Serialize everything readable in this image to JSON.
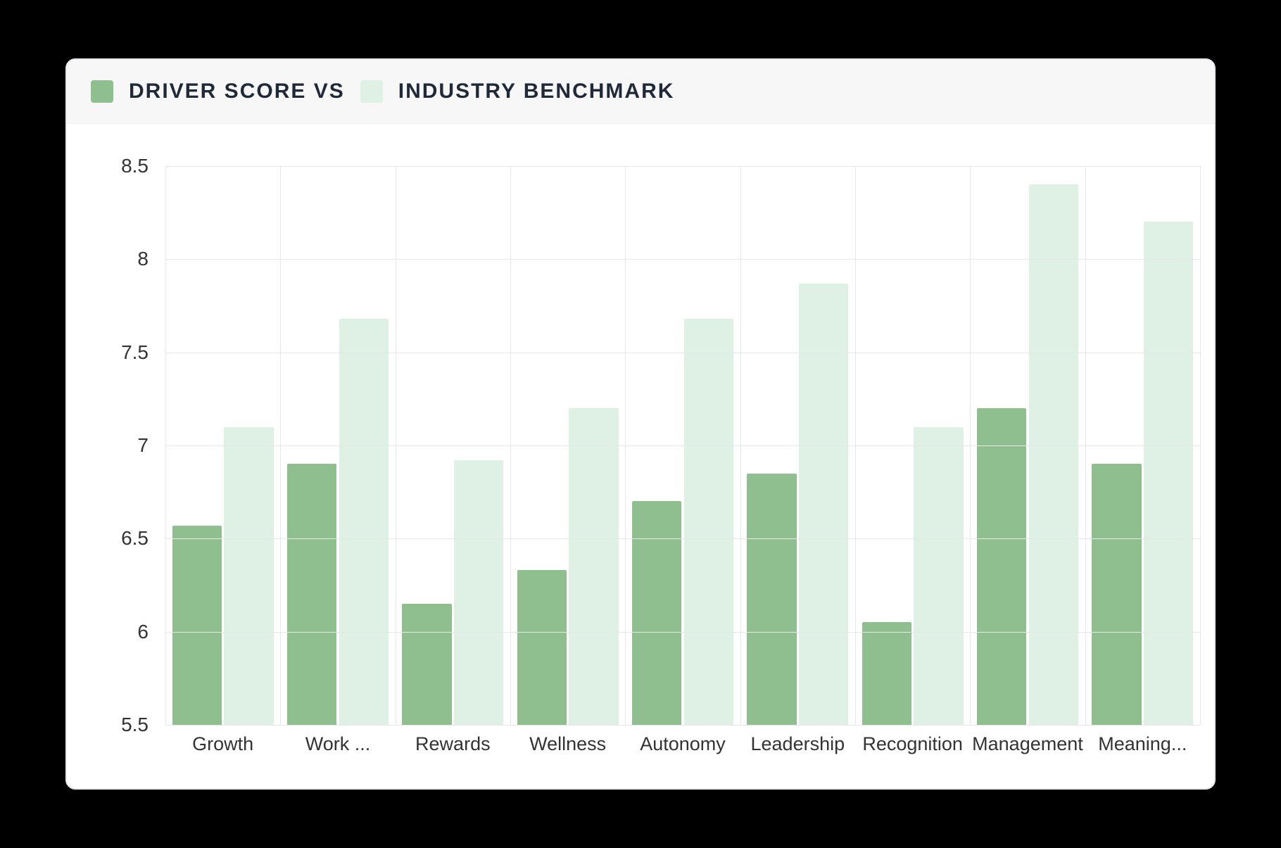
{
  "legend": {
    "driver_label": "DRIVER SCORE VS",
    "benchmark_label": "INDUSTRY BENCHMARK"
  },
  "chart_data": {
    "type": "bar",
    "title": "",
    "xlabel": "",
    "ylabel": "",
    "ylim": [
      5.5,
      8.5
    ],
    "yticks": [
      5.5,
      6,
      6.5,
      7,
      7.5,
      8,
      8.5
    ],
    "categories": [
      "Growth",
      "Work ...",
      "Rewards",
      "Wellness",
      "Autonomy",
      "Leadership",
      "Recognition",
      "Management",
      "Meaning..."
    ],
    "series": [
      {
        "name": "Driver score",
        "values": [
          6.57,
          6.9,
          6.15,
          6.33,
          6.7,
          6.85,
          6.05,
          7.2,
          6.9
        ]
      },
      {
        "name": "Industry benchmark",
        "values": [
          7.1,
          7.68,
          6.92,
          7.2,
          7.68,
          7.87,
          7.1,
          8.4,
          8.2
        ]
      }
    ]
  },
  "ytick_labels": [
    "5.5",
    "6",
    "6.5",
    "7",
    "7.5",
    "8",
    "8.5"
  ],
  "colors": {
    "driver": "#8fbe8f",
    "benchmark": "#dff0e4",
    "grid": "#e6e7e9"
  }
}
